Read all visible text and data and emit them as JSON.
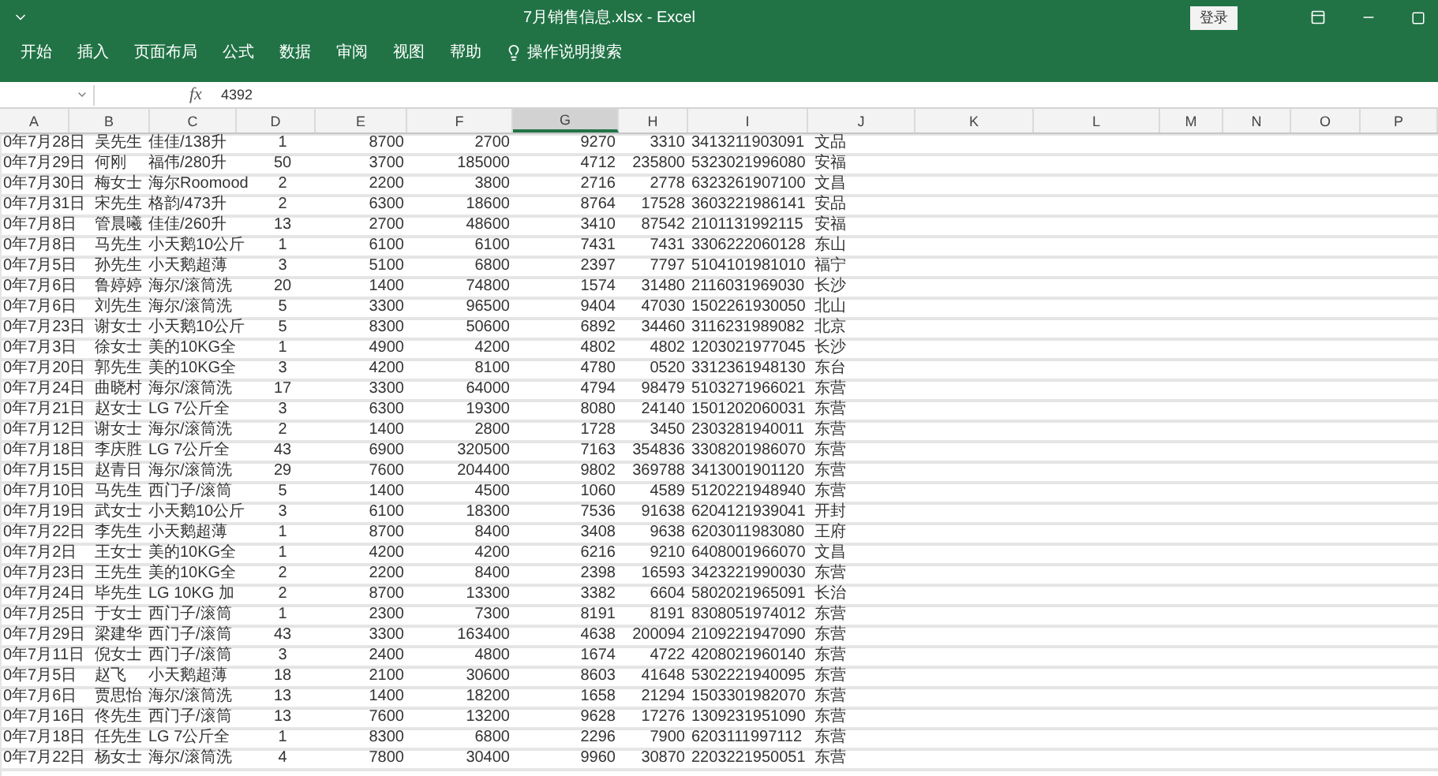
{
  "window": {
    "title": "7月销售信息.xlsx - Excel",
    "sign_in": "登录"
  },
  "ribbon": {
    "tabs": [
      "开始",
      "插入",
      "页面布局",
      "公式",
      "数据",
      "审阅",
      "视图",
      "帮助"
    ],
    "search": "操作说明搜索"
  },
  "formula_bar": {
    "function_label": "fx",
    "value": "4392"
  },
  "sheet": {
    "columns": [
      {
        "label": "A",
        "selected": false
      },
      {
        "label": "B",
        "selected": false
      },
      {
        "label": "C",
        "selected": false
      },
      {
        "label": "D",
        "selected": false
      },
      {
        "label": "E",
        "selected": false
      },
      {
        "label": "F",
        "selected": false
      },
      {
        "label": "G",
        "selected": true
      },
      {
        "label": "H",
        "selected": false
      },
      {
        "label": "I",
        "selected": false
      },
      {
        "label": "J",
        "selected": false
      },
      {
        "label": "K",
        "selected": false
      },
      {
        "label": "L",
        "selected": false
      },
      {
        "label": "M",
        "selected": false
      },
      {
        "label": "N",
        "selected": false
      },
      {
        "label": "O",
        "selected": false
      },
      {
        "label": "P",
        "selected": false
      }
    ],
    "rows": [
      [
        "0年7月28日",
        "吴先生",
        "佳佳/138升",
        "1",
        "8700",
        "2700",
        "9270",
        "3310",
        "3413211903091",
        "文品"
      ],
      [
        "0年7月29日",
        "何刚",
        "福伟/280升",
        "50",
        "3700",
        "185000",
        "4712",
        "235800",
        "5323021996080",
        "安福"
      ],
      [
        "0年7月30日",
        "梅女士",
        "海尔Roomood",
        "2",
        "2200",
        "3800",
        "2716",
        "2778",
        "6323261907100",
        "文昌"
      ],
      [
        "0年7月31日",
        "宋先生",
        "格韵/473升",
        "2",
        "6300",
        "18600",
        "8764",
        "17528",
        "3603221986141",
        "安品"
      ],
      [
        "0年7月8日",
        "管晨曦",
        "佳佳/260升",
        "13",
        "2700",
        "48600",
        "3410",
        "87542",
        "2101131992115",
        "安福"
      ],
      [
        "0年7月8日",
        "马先生",
        "小天鹅10公斤",
        "1",
        "6100",
        "6100",
        "7431",
        "7431",
        "3306222060128",
        "东山"
      ],
      [
        "0年7月5日",
        "孙先生",
        "小天鹅超薄",
        "3",
        "5100",
        "6800",
        "2397",
        "7797",
        "5104101981010",
        "福宁"
      ],
      [
        "0年7月6日",
        "鲁婷婷",
        "海尔/滚筒洗",
        "20",
        "1400",
        "74800",
        "1574",
        "31480",
        "2116031969030",
        "长沙"
      ],
      [
        "0年7月6日",
        "刘先生",
        "海尔/滚筒洗",
        "5",
        "3300",
        "96500",
        "9404",
        "47030",
        "1502261930050",
        "北山"
      ],
      [
        "0年7月23日",
        "谢女士",
        "小天鹅10公斤",
        "5",
        "8300",
        "50600",
        "6892",
        "34460",
        "3116231989082",
        "北京"
      ],
      [
        "0年7月3日",
        "徐女士",
        "美的10KG全",
        "1",
        "4900",
        "4200",
        "4802",
        "4802",
        "1203021977045",
        "长沙"
      ],
      [
        "0年7月20日",
        "郭先生",
        "美的10KG全",
        "3",
        "4200",
        "8100",
        "4780",
        "0520",
        "3312361948130",
        "东台"
      ],
      [
        "0年7月24日",
        "曲晓村",
        "海尔/滚筒洗",
        "17",
        "3300",
        "64000",
        "4794",
        "98479",
        "5103271966021",
        "东营"
      ],
      [
        "0年7月21日",
        "赵女士",
        "LG 7公斤全",
        "3",
        "6300",
        "19300",
        "8080",
        "24140",
        "1501202060031",
        "东营"
      ],
      [
        "0年7月12日",
        "谢女士",
        "海尔/滚筒洗",
        "2",
        "1400",
        "2800",
        "1728",
        "3450",
        "2303281940011",
        "东营"
      ],
      [
        "0年7月18日",
        "李庆胜",
        "LG 7公斤全",
        "43",
        "6900",
        "320500",
        "7163",
        "354836",
        "3308201986070",
        "东营"
      ],
      [
        "0年7月15日",
        "赵青日",
        "海尔/滚筒洗",
        "29",
        "7600",
        "204400",
        "9802",
        "369788",
        "3413001901120",
        "东营"
      ],
      [
        "0年7月10日",
        "马先生",
        "西门子/滚筒",
        "5",
        "1400",
        "4500",
        "1060",
        "4589",
        "5120221948940",
        "东营"
      ],
      [
        "0年7月19日",
        "武女士",
        "小天鹅10公斤",
        "3",
        "6100",
        "18300",
        "7536",
        "91638",
        "6204121939041",
        "开封"
      ],
      [
        "0年7月22日",
        "李先生",
        "小天鹅超薄",
        "1",
        "8700",
        "8400",
        "3408",
        "9638",
        "6203011983080",
        "王府"
      ],
      [
        "0年7月2日",
        "王女士",
        "美的10KG全",
        "1",
        "4200",
        "4200",
        "6216",
        "9210",
        "6408001966070",
        "文昌"
      ],
      [
        "0年7月23日",
        "王先生",
        "美的10KG全",
        "2",
        "2200",
        "8400",
        "2398",
        "16593",
        "3423221990030",
        "东营"
      ],
      [
        "0年7月24日",
        "毕先生",
        "LG 10KG 加",
        "2",
        "8700",
        "13300",
        "3382",
        "6604",
        "5802021965091",
        "长治"
      ],
      [
        "0年7月25日",
        "于女士",
        "西门子/滚筒",
        "1",
        "2300",
        "7300",
        "8191",
        "8191",
        "8308051974012",
        "东营"
      ],
      [
        "0年7月29日",
        "梁建华",
        "西门子/滚筒",
        "43",
        "3300",
        "163400",
        "4638",
        "200094",
        "2109221947090",
        "东营"
      ],
      [
        "0年7月11日",
        "倪女士",
        "西门子/滚筒",
        "3",
        "2400",
        "4800",
        "1674",
        "4722",
        "4208021960140",
        "东营"
      ],
      [
        "0年7月5日",
        "赵飞",
        "小天鹅超薄",
        "18",
        "2100",
        "30600",
        "8603",
        "41648",
        "5302221940095",
        "东营"
      ],
      [
        "0年7月6日",
        "贾思怡",
        "海尔/滚筒洗",
        "13",
        "1400",
        "18200",
        "1658",
        "21294",
        "1503301982070",
        "东营"
      ],
      [
        "0年7月16日",
        "佟先生",
        "西门子/滚筒",
        "13",
        "7600",
        "13200",
        "9628",
        "17276",
        "1309231951090",
        "东营"
      ],
      [
        "0年7月18日",
        "任先生",
        "LG 7公斤全",
        "1",
        "8300",
        "6800",
        "2296",
        "7900",
        "6203111997112",
        "东营"
      ],
      [
        "0年7月22日",
        "杨女士",
        "海尔/滚筒洗",
        "4",
        "7800",
        "30400",
        "9960",
        "30870",
        "2203221950051",
        "东营"
      ]
    ]
  }
}
